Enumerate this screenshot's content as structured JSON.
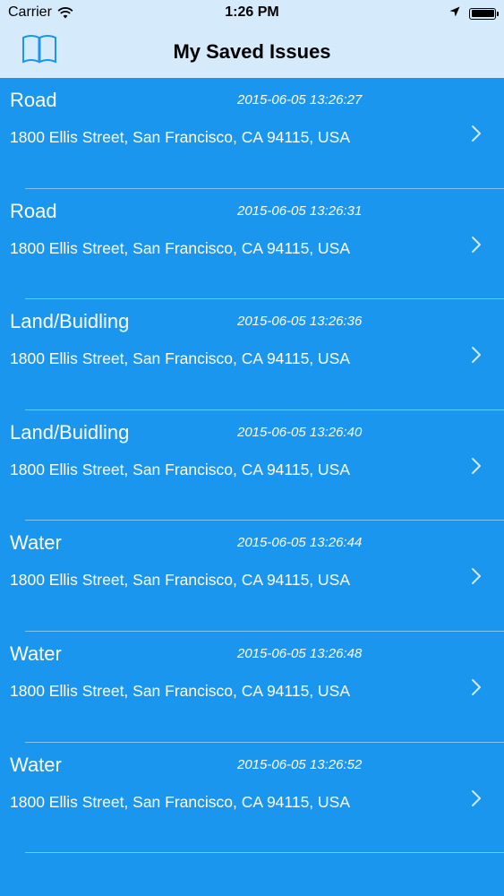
{
  "status_bar": {
    "carrier": "Carrier",
    "time": "1:26 PM",
    "wifi_icon": "wifi-icon",
    "location_icon": "location-arrow-icon",
    "battery_icon": "battery-icon"
  },
  "nav": {
    "title": "My Saved Issues",
    "left_icon": "book-icon",
    "accent_color": "#1a96ee",
    "bar_color": "#d5ebfb"
  },
  "issues": [
    {
      "category": "Road",
      "timestamp": "2015-06-05 13:26:27",
      "address": "1800 Ellis Street, San Francisco, CA 94115, USA"
    },
    {
      "category": "Road",
      "timestamp": "2015-06-05 13:26:31",
      "address": "1800 Ellis Street, San Francisco, CA 94115, USA"
    },
    {
      "category": "Land/Buidling",
      "timestamp": "2015-06-05 13:26:36",
      "address": "1800 Ellis Street, San Francisco, CA 94115, USA"
    },
    {
      "category": "Land/Buidling",
      "timestamp": "2015-06-05 13:26:40",
      "address": "1800 Ellis Street, San Francisco, CA 94115, USA"
    },
    {
      "category": "Water",
      "timestamp": "2015-06-05 13:26:44",
      "address": "1800 Ellis Street, San Francisco, CA 94115, USA"
    },
    {
      "category": "Water",
      "timestamp": "2015-06-05 13:26:48",
      "address": "1800 Ellis Street, San Francisco, CA 94115, USA"
    },
    {
      "category": "Water",
      "timestamp": "2015-06-05 13:26:52",
      "address": "1800 Ellis Street, San Francisco, CA 94115, USA"
    }
  ]
}
